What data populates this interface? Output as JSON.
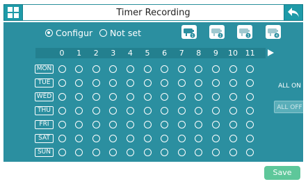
{
  "header": {
    "title": "Timer Recording",
    "menu_icon": "grid-icon",
    "back_icon": "back-arrow-icon"
  },
  "mode": {
    "options": [
      {
        "label": "Configur",
        "selected": true
      },
      {
        "label": "Not set",
        "selected": false
      }
    ]
  },
  "cameras": [
    {
      "number": "1",
      "icon": "camera-1-icon",
      "active": true
    },
    {
      "number": "2",
      "icon": "camera-2-icon",
      "active": false
    },
    {
      "number": "3",
      "icon": "camera-3-icon",
      "active": false
    },
    {
      "number": "4",
      "icon": "camera-4-icon",
      "active": false
    }
  ],
  "schedule": {
    "hours": [
      "0",
      "1",
      "2",
      "3",
      "4",
      "5",
      "6",
      "7",
      "8",
      "9",
      "10",
      "11"
    ],
    "next_page_icon": "play-right-icon",
    "days": [
      "MON",
      "TUE",
      "WED",
      "THU",
      "FRI",
      "SAT",
      "SUN"
    ],
    "slot_state": "empty"
  },
  "actions": {
    "all_on": "ALL ON",
    "all_off": "ALL OFF",
    "save": "Save"
  },
  "colors": {
    "panel": "#2b8fa0",
    "header_button": "#1e9aa8",
    "save": "#5ec79a"
  }
}
